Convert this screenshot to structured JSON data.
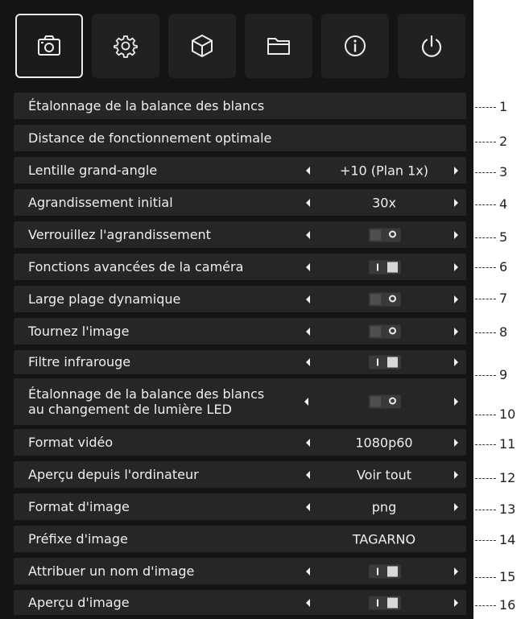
{
  "toolbar": [
    {
      "icon": "camera-icon",
      "active": true
    },
    {
      "icon": "gear-icon",
      "active": false
    },
    {
      "icon": "cube-icon",
      "active": false
    },
    {
      "icon": "folder-icon",
      "active": false
    },
    {
      "icon": "info-icon",
      "active": false
    },
    {
      "icon": "power-icon",
      "active": false
    }
  ],
  "menu": {
    "white_balance": {
      "label": "Étalonnage de la balance des blancs",
      "callout": "1"
    },
    "working_distance": {
      "label": "Distance de fonctionnement optimale",
      "callout": "2"
    },
    "wide_angle_lens": {
      "label": "Lentille grand-angle",
      "value": "+10 (Plan 1x)",
      "callout": "3"
    },
    "initial_magnification": {
      "label": "Agrandissement initial",
      "value": "30x",
      "callout": "4"
    },
    "lock_magnification": {
      "label": "Verrouillez l'agrandissement",
      "toggle": "off",
      "callout": "5"
    },
    "advanced_camera": {
      "label": "Fonctions avancées de la caméra",
      "toggle": "on",
      "callout": "6"
    },
    "wide_dynamic_range": {
      "label": "Large plage dynamique",
      "toggle": "off",
      "callout": "7"
    },
    "rotate_image": {
      "label": "Tournez l'image",
      "toggle": "off",
      "callout": "8"
    },
    "infrared_filter": {
      "label": "Filtre infrarouge",
      "toggle": "on",
      "callout": "9"
    },
    "wb_led_change": {
      "label_line1": "Étalonnage de la balance des blancs",
      "label_line2": "au changement de lumière LED",
      "toggle": "off",
      "callout": "10"
    },
    "video_format": {
      "label": "Format vidéo",
      "value": "1080p60",
      "callout": "11"
    },
    "pc_preview": {
      "label": "Aperçu depuis l'ordinateur",
      "value": "Voir tout",
      "callout": "12"
    },
    "image_format": {
      "label": "Format d'image",
      "value": "png",
      "callout": "13"
    },
    "image_prefix": {
      "label": "Préfixe d'image",
      "value": "TAGARNO",
      "callout": "14"
    },
    "name_image": {
      "label": "Attribuer un nom d'image",
      "toggle": "on",
      "callout": "15"
    },
    "image_preview": {
      "label": "Aperçu d'image",
      "toggle": "on",
      "callout": "16"
    }
  }
}
